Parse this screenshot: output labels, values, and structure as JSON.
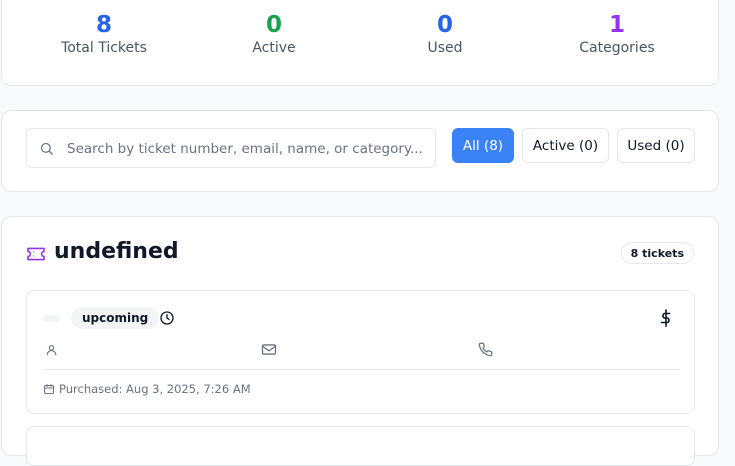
{
  "stats": [
    {
      "value": "8",
      "label": "Total Tickets",
      "color": "#2563eb"
    },
    {
      "value": "0",
      "label": "Active",
      "color": "#16a34a"
    },
    {
      "value": "0",
      "label": "Used",
      "color": "#2563eb"
    },
    {
      "value": "1",
      "label": "Categories",
      "color": "#9333ea"
    }
  ],
  "search": {
    "placeholder": "Search by ticket number, email, name, or category...",
    "icon": "search-icon"
  },
  "filters": {
    "all": "All (8)",
    "active": "Active (0)",
    "used": "Used (0)"
  },
  "category": {
    "title": "undefined",
    "count": "8 tickets",
    "icon": "ticket-icon",
    "icon_color": "#9333ea"
  },
  "ticket": {
    "status": "upcoming",
    "purchased": "Purchased: Aug 3, 2025, 7:26 AM"
  },
  "colors": {
    "accent": "#3b82f6",
    "border": "#e5e7eb"
  }
}
